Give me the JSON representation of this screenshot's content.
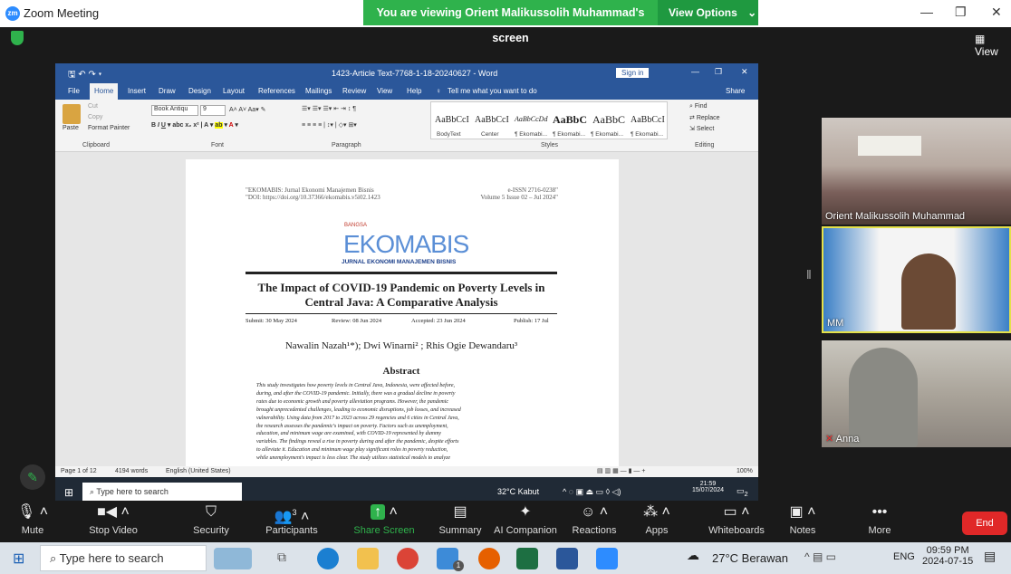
{
  "zoom": {
    "window_title": "Zoom Meeting",
    "logo_text": "zm",
    "share_banner": "You are viewing Orient Malikussolih Muhammad's screen",
    "view_options": "View Options",
    "view_button": "View",
    "controls": [
      {
        "label": "Mute",
        "icon": "mic-icon"
      },
      {
        "label": "Stop Video",
        "icon": "video-icon"
      },
      {
        "label": "Security",
        "icon": "shield-icon"
      },
      {
        "label": "Participants",
        "icon": "participants-icon",
        "badge": "3"
      },
      {
        "label": "Share Screen",
        "icon": "share-screen-icon"
      },
      {
        "label": "Summary",
        "icon": "summary-icon"
      },
      {
        "label": "AI Companion",
        "icon": "ai-companion-icon"
      },
      {
        "label": "Reactions",
        "icon": "reactions-icon"
      },
      {
        "label": "Apps",
        "icon": "apps-icon"
      },
      {
        "label": "Whiteboards",
        "icon": "whiteboard-icon"
      },
      {
        "label": "Notes",
        "icon": "notes-icon"
      },
      {
        "label": "More",
        "icon": "more-icon"
      }
    ],
    "end_label": "End",
    "participants": [
      {
        "name": "Orient Malikussolih Muhammad"
      },
      {
        "name": "MM"
      },
      {
        "name": "Anna"
      }
    ]
  },
  "word": {
    "doc_title": "1423-Article Text-7768-1-18-20240627 - Word",
    "sign_in": "Sign in",
    "tabs": [
      "File",
      "Home",
      "Insert",
      "Draw",
      "Design",
      "Layout",
      "References",
      "Mailings",
      "Review",
      "View",
      "Help"
    ],
    "tell_me": "Tell me what you want to do",
    "share": "Share",
    "clipboard": {
      "paste": "Paste",
      "cut": "Cut",
      "copy": "Copy",
      "format_painter": "Format Painter",
      "group": "Clipboard"
    },
    "font": {
      "name": "Book Antiqu",
      "size": "9",
      "group": "Font"
    },
    "paragraph_group": "Paragraph",
    "styles": [
      {
        "preview": "AaBbCcI",
        "name": "BodyText"
      },
      {
        "preview": "AaBbCcI",
        "name": "Center"
      },
      {
        "preview": "AaBbCcDd",
        "name": "¶ Ekomabi..."
      },
      {
        "preview": "AaBbC",
        "name": "¶ Ekomabi..."
      },
      {
        "preview": "AaBbC",
        "name": "¶ Ekomabi..."
      },
      {
        "preview": "AaBbCcI",
        "name": "¶ Ekomabi..."
      }
    ],
    "styles_group": "Styles",
    "editing": {
      "find": "Find",
      "replace": "Replace",
      "select": "Select",
      "group": "Editing"
    },
    "status": {
      "page": "Page 1 of 12",
      "words": "4194 words",
      "language": "English (United States)",
      "zoom": "100%"
    }
  },
  "document": {
    "header_left_1": "\"EKOMABIS: Jurnal Ekonomi Manajemen Bisnis",
    "header_left_2": "\"DOI: https://doi.org/10.37366/ekomabis.v5i02.1423",
    "header_right_1": "e-ISSN 2716-0238\"",
    "header_right_2": "Volume 5 Issue 02 – Jul 2024\"",
    "logo_top": "BANGSA",
    "logo_main": "EKOMABIS",
    "logo_sub": "JURNAL EKONOMI MANAJEMEN BISNIS",
    "title_1": "The Impact of COVID-19 Pandemic on Poverty Levels in",
    "title_2": "Central Java: A Comparative Analysis",
    "submit": "Submit: 30 May 2024",
    "review": "Review: 08 Jun 2024",
    "accepted": "Accepted: 23 Jun 2024",
    "publish": "Publish: 17 Jul",
    "authors": "Nawalin Nazah¹*); Dwi Winarni² ; Rhis Ogie Dewandaru³",
    "abstract_heading": "Abstract",
    "abstract_lines": [
      "This study investigates how poverty levels in Central Java, Indonesia, were affected before,",
      "during, and after the COVID-19 pandemic. Initially, there was a gradual decline in poverty",
      "rates due to economic growth and poverty alleviation programs. However, the pandemic",
      "brought unprecedented challenges, leading to economic disruptions, job losses, and increased",
      "vulnerability. Using data from 2017 to 2023 across 29 regencies and 6 cities in Central Java,",
      "the research assesses the pandemic's impact on poverty. Factors such as unemployment,",
      "education, and minimum wage are examined, with COVID-19 represented by dummy",
      "variables. The findings reveal a rise in poverty during and after the pandemic, despite efforts",
      "to alleviate it. Education and minimum wage play significant roles in poverty reduction,",
      "while unemployment's impact is less clear. The study utilizes statistical models to analyze"
    ]
  },
  "inner_taskbar": {
    "search": "Type here to search",
    "weather": "32°C Kabut",
    "time": "21:59",
    "date": "15/07/2024",
    "notif": "2"
  },
  "taskbar": {
    "search": "Type here to search",
    "weather": "27°C Berawan",
    "lang": "ENG",
    "time": "09:59 PM",
    "date": "2024-07-15",
    "badge": "1"
  }
}
